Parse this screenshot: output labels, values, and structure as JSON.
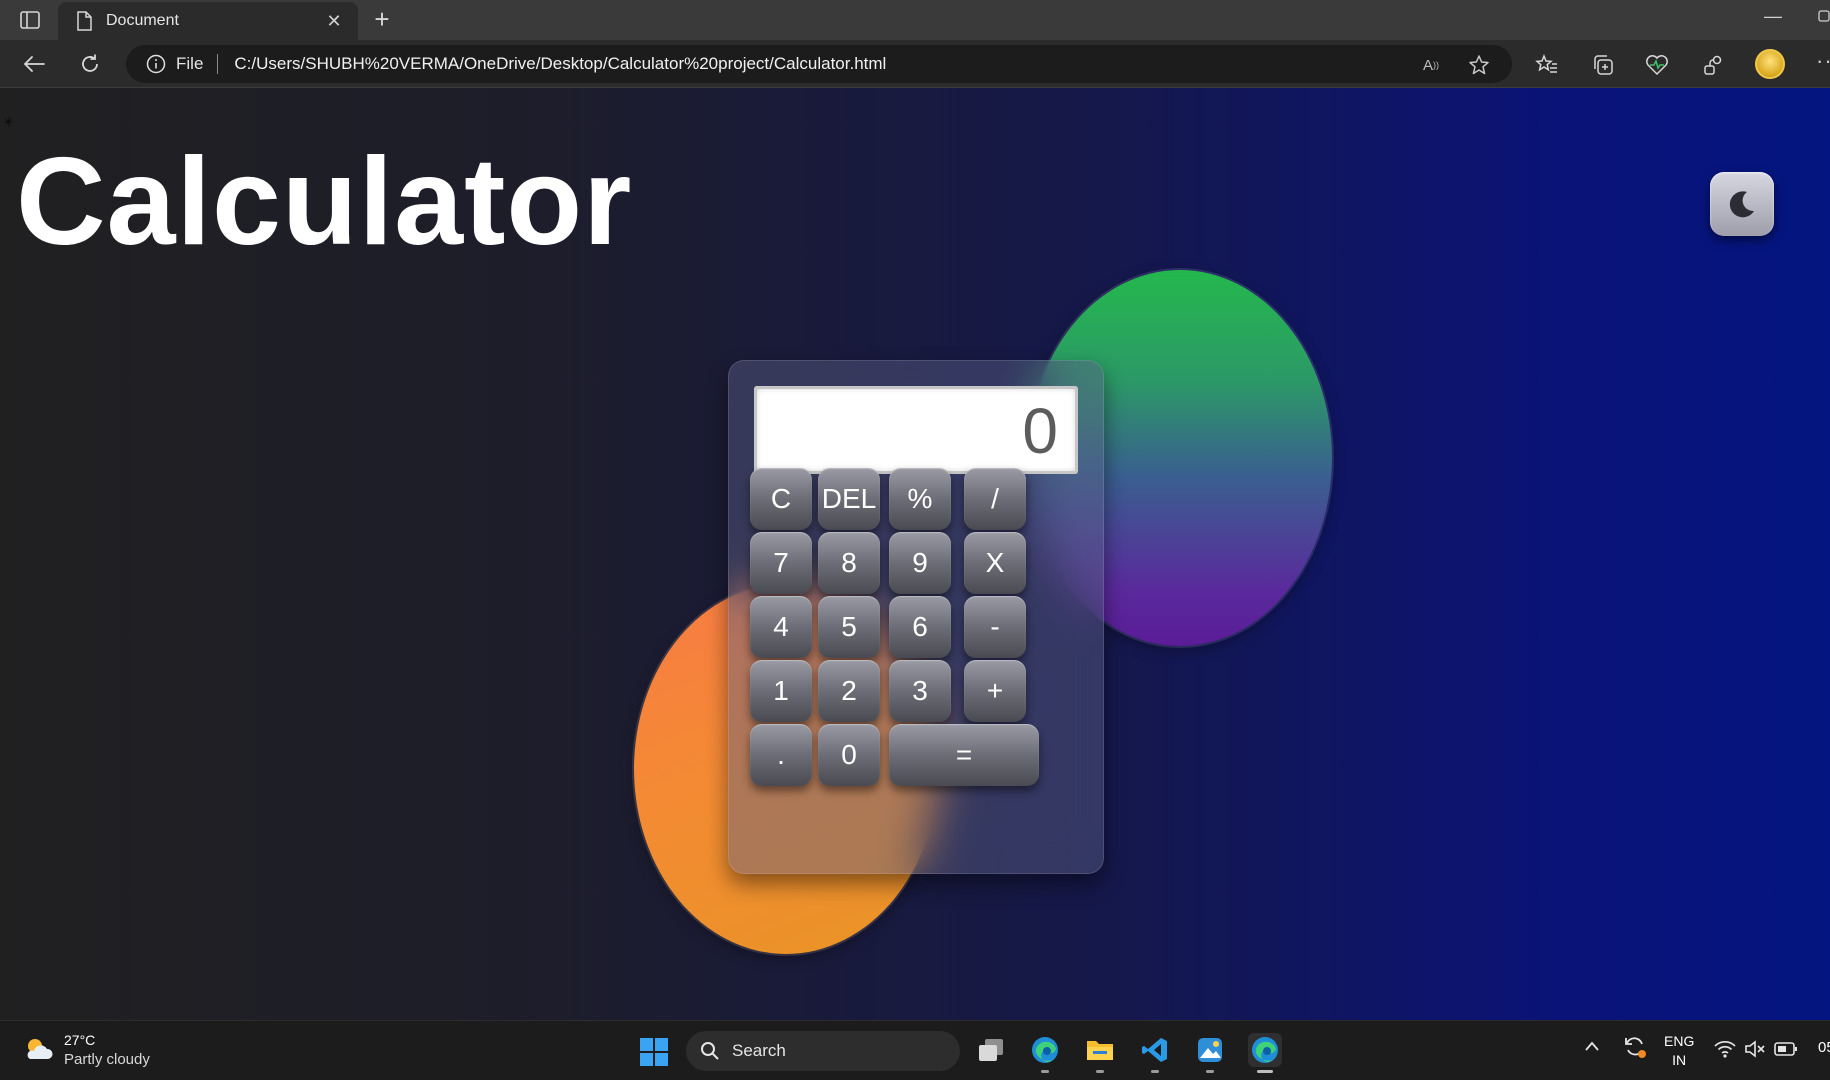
{
  "browser": {
    "tab_title": "Document",
    "tab_close": "✕",
    "new_tab": "+",
    "minimize": "—",
    "address_scheme": "File",
    "address_url": "C:/Users/SHUBH%20VERMA/OneDrive/Desktop/Calculator%20project/Calculator.html",
    "read_aloud": "A",
    "more": "···"
  },
  "page": {
    "sun_glyph": "☀",
    "title": "Calculator"
  },
  "calculator": {
    "display": "0",
    "keys": [
      "C",
      "DEL",
      "%",
      "/",
      "7",
      "8",
      "9",
      "X",
      "4",
      "5",
      "6",
      "-",
      "1",
      "2",
      "3",
      "+",
      ".",
      "0",
      "="
    ]
  },
  "taskbar": {
    "temperature": "27°C",
    "weather": "Partly cloudy",
    "search_label": "Search",
    "lang_top": "ENG",
    "lang_bottom": "IN",
    "clock": "05"
  },
  "colors": {
    "green_blob": "#24b84d",
    "purple_blob": "#5b1c98",
    "orange_blob": "#f48a34",
    "page_right": "#041581"
  }
}
